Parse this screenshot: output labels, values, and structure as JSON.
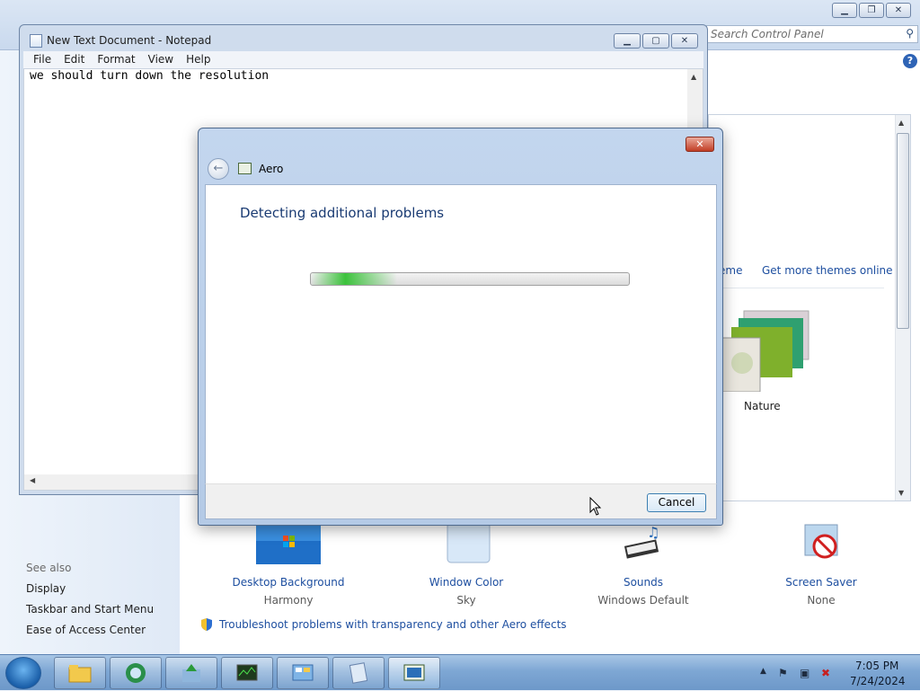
{
  "control_panel": {
    "search_placeholder": "Search Control Panel",
    "help_label": "?",
    "see_also": "See also",
    "links": [
      "Display",
      "Taskbar and Start Menu",
      "Ease of Access Center"
    ],
    "theme_link_partial": "eme",
    "get_more_themes": "Get more themes online",
    "nature_label": "Nature",
    "bottom_items": [
      {
        "label": "Desktop Background",
        "value": "Harmony"
      },
      {
        "label": "Window Color",
        "value": "Sky"
      },
      {
        "label": "Sounds",
        "value": "Windows Default"
      },
      {
        "label": "Screen Saver",
        "value": "None"
      }
    ],
    "troubleshoot_link": "Troubleshoot problems with transparency and other Aero effects"
  },
  "notepad": {
    "title": "New Text Document - Notepad",
    "menu": [
      "File",
      "Edit",
      "Format",
      "View",
      "Help"
    ],
    "content": "we should turn down the resolution"
  },
  "dialog": {
    "title": "Aero",
    "heading": "Detecting additional problems",
    "progress_fraction": 0.27,
    "cancel_label": "Cancel",
    "close_glyph": "✕"
  },
  "taskbar": {
    "time": "7:05 PM",
    "date": "7/24/2024"
  },
  "colors": {
    "link": "#1e4fa0",
    "heading": "#1a3b73",
    "progress": "#3cc23c"
  }
}
